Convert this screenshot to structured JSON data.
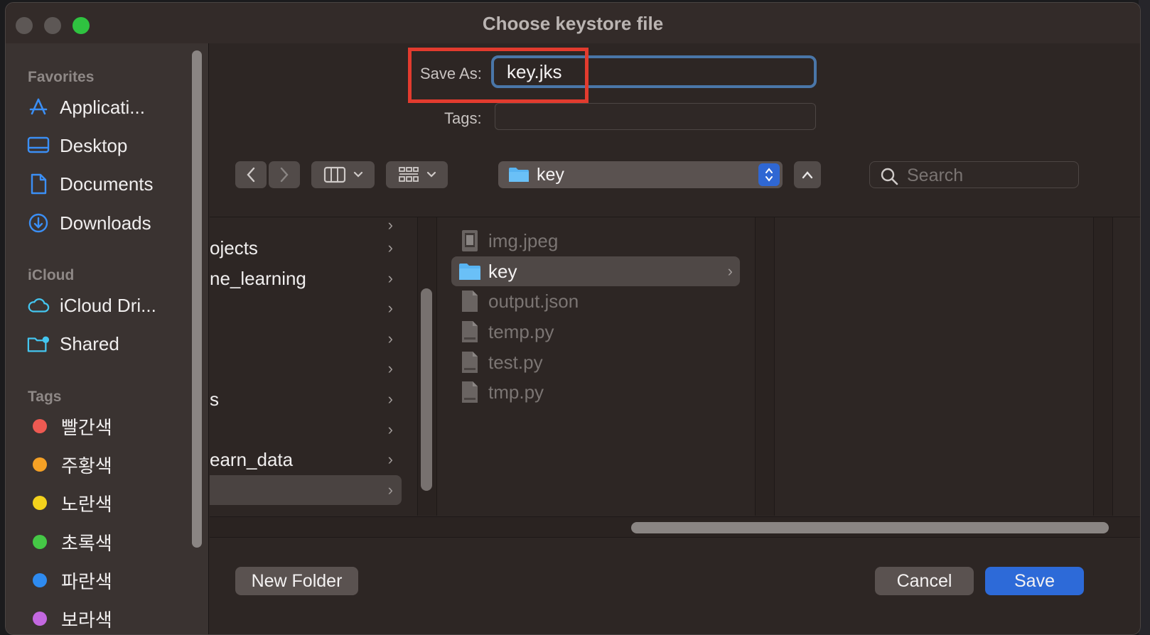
{
  "window": {
    "title": "Choose keystore file"
  },
  "sidebar": {
    "favorites_header": "Favorites",
    "favorites": [
      {
        "label": "Applicati...",
        "icon": "applications-icon"
      },
      {
        "label": "Desktop",
        "icon": "desktop-icon"
      },
      {
        "label": "Documents",
        "icon": "document-icon"
      },
      {
        "label": "Downloads",
        "icon": "downloads-icon"
      }
    ],
    "icloud_header": "iCloud",
    "icloud": [
      {
        "label": "iCloud Dri...",
        "icon": "cloud-icon"
      },
      {
        "label": "Shared",
        "icon": "shared-folder-icon"
      }
    ],
    "tags_header": "Tags",
    "tags": [
      {
        "label": "빨간색",
        "color": "#ee5a52"
      },
      {
        "label": "주황색",
        "color": "#f5a125"
      },
      {
        "label": "노란색",
        "color": "#f3d21c"
      },
      {
        "label": "초록색",
        "color": "#45c846"
      },
      {
        "label": "파란색",
        "color": "#2e8bf0"
      },
      {
        "label": "보라색",
        "color": "#c368e0"
      }
    ]
  },
  "form": {
    "save_as_label": "Save As:",
    "save_as_value": "key.jks",
    "tags_label": "Tags:"
  },
  "toolbar": {
    "path": "key",
    "search_placeholder": "Search"
  },
  "browser": {
    "column1": [
      {
        "label": "",
        "selected": false
      },
      {
        "label": "ojects",
        "selected": false
      },
      {
        "label": "ne_learning",
        "selected": false
      },
      {
        "label": "",
        "selected": false
      },
      {
        "label": "",
        "selected": false
      },
      {
        "label": "",
        "selected": false
      },
      {
        "label": "s",
        "selected": false
      },
      {
        "label": "",
        "selected": false
      },
      {
        "label": "earn_data",
        "selected": false
      },
      {
        "label": "",
        "selected": true
      }
    ],
    "column2": [
      {
        "label": "img.jpeg",
        "kind": "image",
        "selected": false
      },
      {
        "label": "key",
        "kind": "folder",
        "selected": true
      },
      {
        "label": "output.json",
        "kind": "file",
        "selected": false
      },
      {
        "label": "temp.py",
        "kind": "python",
        "selected": false
      },
      {
        "label": "test.py",
        "kind": "python",
        "selected": false
      },
      {
        "label": "tmp.py",
        "kind": "python",
        "selected": false
      }
    ]
  },
  "footer": {
    "new_folder": "New Folder",
    "cancel": "Cancel",
    "save": "Save"
  }
}
